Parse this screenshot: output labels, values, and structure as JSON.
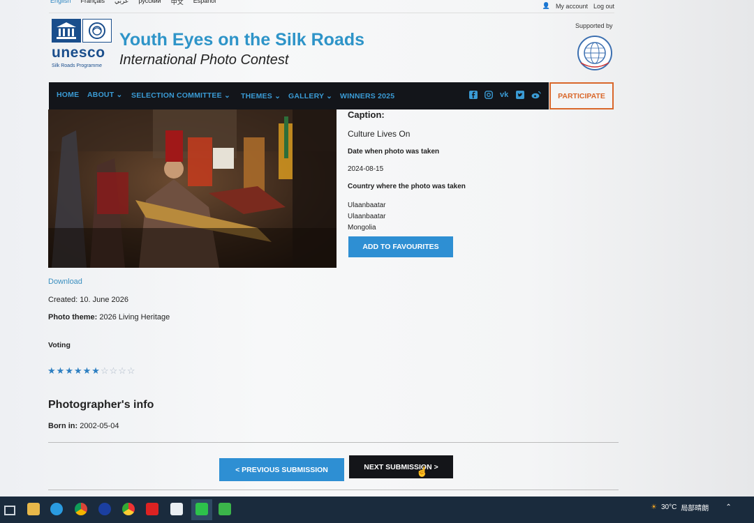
{
  "languages": [
    "English",
    "Français",
    "عربي",
    "русский",
    "中文",
    "Español"
  ],
  "account": {
    "my_account": "My account",
    "logout": "Log out"
  },
  "brand": {
    "logo_text": "unesco",
    "logo_sub": "Silk Roads Programme",
    "title": "Youth Eyes on the Silk Roads",
    "subtitle": "International Photo Contest",
    "supported_by": "Supported by"
  },
  "nav": {
    "items": [
      "HOME",
      "ABOUT",
      "SELECTION COMMITTEE",
      "THEMES",
      "GALLERY",
      "WINNERS 2025"
    ],
    "participate": "PARTICIPATE",
    "social_icons": [
      "facebook-icon",
      "instagram-icon",
      "vk-icon",
      "twitter-icon",
      "weibo-icon"
    ]
  },
  "details": {
    "caption_label": "Caption:",
    "caption_value": "Culture Lives On",
    "date_label": "Date when photo was taken",
    "date_value": "2024-08-15",
    "country_label": "Country where the photo was taken",
    "location_lines": [
      "Ulaanbaatar",
      "Ulaanbaatar",
      "Mongolia"
    ],
    "favourite_button": "ADD TO FAVOURITES"
  },
  "meta": {
    "download": "Download",
    "created_label": "Created:",
    "created_value": "10. June 2026",
    "theme_label": "Photo theme:",
    "theme_value": "2026 Living Heritage",
    "voting_label": "Voting",
    "rating": 6,
    "rating_max": 10
  },
  "photographer": {
    "heading": "Photographer's info",
    "born_label": "Born in:",
    "born_value": "2002-05-04"
  },
  "pager": {
    "previous": "< PREVIOUS SUBMISSION",
    "next": "NEXT SUBMISSION >"
  },
  "taskbar": {
    "weather": "30°C",
    "weather_desc": "局部晴朗"
  }
}
